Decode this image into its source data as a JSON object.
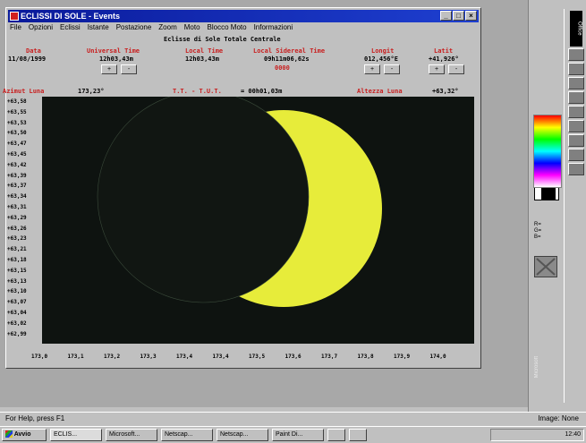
{
  "window": {
    "title": "ECLISSI DI SOLE - Events",
    "buttons": {
      "minimize": "_",
      "maximize": "□",
      "close": "×"
    }
  },
  "menu": [
    "File",
    "Opzioni",
    "Eclissi",
    "Istante",
    "Postazione",
    "Zoom",
    "Moto",
    "Blocco Moto",
    "Informazioni"
  ],
  "header": {
    "title": "Eclisse di Sole  Totale Centrale",
    "data_label": "Data",
    "data_value": "11/08/1999",
    "universal_label": "Universal Time",
    "universal_value": "12h03,43m",
    "local_label": "Local Time",
    "local_value": "12h03,43m",
    "sidereal_label": "Local Sidereal Time",
    "sidereal_value": "09h11m06,62s",
    "mode_label": "0000",
    "longit_label": "Longit",
    "longit_value": "012,456°E",
    "latit_label": "Latit",
    "latit_value": "+41,926°",
    "azimut_label": "Azimut Luna",
    "azimut_value": "173,23°",
    "dt_label": "T.T. - T.U.T.",
    "dt_value": "= 00h01,03m",
    "altezza_label": "Altezza Luna",
    "altezza_value": "+63,32°"
  },
  "y_ticks": [
    "+63,58",
    "+63,55",
    "+63,53",
    "+63,50",
    "+63,47",
    "+63,45",
    "+63,42",
    "+63,39",
    "+63,37",
    "+63,34",
    "+63,31",
    "+63,29",
    "+63,26",
    "+63,23",
    "+63,21",
    "+63,18",
    "+63,15",
    "+63,13",
    "+63,10",
    "+63,07",
    "+63,04",
    "+63,02",
    "+62,99"
  ],
  "x_ticks": [
    "173,0",
    "173,1",
    "173,2",
    "173,3",
    "173,4",
    "173,4",
    "173,5",
    "173,6",
    "173,7",
    "173,8",
    "173,9",
    "174,0"
  ],
  "colors": {
    "sun": "#e7ec3a",
    "moon": "#111612",
    "plot_bg": "#0e1310",
    "title_bar": "#0a1a9a"
  },
  "palette": {
    "labels": [
      "R=",
      "G=",
      "B="
    ]
  },
  "office_bar": {
    "label": "Office"
  },
  "status_bar": {
    "left": "For Help, press F1",
    "right": "Image: None"
  },
  "taskbar": {
    "start": "Avvio",
    "items": [
      "ECLIS...",
      "Microsoft...",
      "Netscap...",
      "Netscap...",
      "Paint Di...",
      "",
      ""
    ],
    "clock": "12:40"
  },
  "watermark": "Microsoft"
}
